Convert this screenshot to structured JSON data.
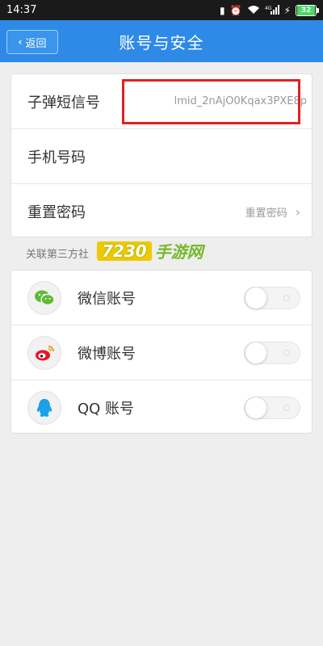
{
  "status_bar": {
    "time": "14:37",
    "network": "4G",
    "battery": "32",
    "icons": [
      "notification-icon",
      "alarm-icon",
      "wifi-icon",
      "signal-icon",
      "charging-icon",
      "battery-icon"
    ]
  },
  "header": {
    "back_label": "返回",
    "title": "账号与安全"
  },
  "account_rows": [
    {
      "label": "子弹短信号",
      "value": "lmid_2nAjO0Kqax3PXE8p"
    },
    {
      "label": "手机号码",
      "value": ""
    },
    {
      "label": "重置密码",
      "value": "重置密码"
    }
  ],
  "section_label": "关联第三方社",
  "watermark": {
    "number": "7230",
    "text": "手游网"
  },
  "social_rows": [
    {
      "label": "微信账号",
      "icon": "wechat-icon",
      "enabled": false
    },
    {
      "label": "微博账号",
      "icon": "weibo-icon",
      "enabled": false
    },
    {
      "label": "QQ 账号",
      "icon": "qq-icon",
      "enabled": false
    }
  ],
  "colors": {
    "header": "#2e8ae6",
    "highlight": "#e0211f",
    "background": "#eeeeee"
  }
}
